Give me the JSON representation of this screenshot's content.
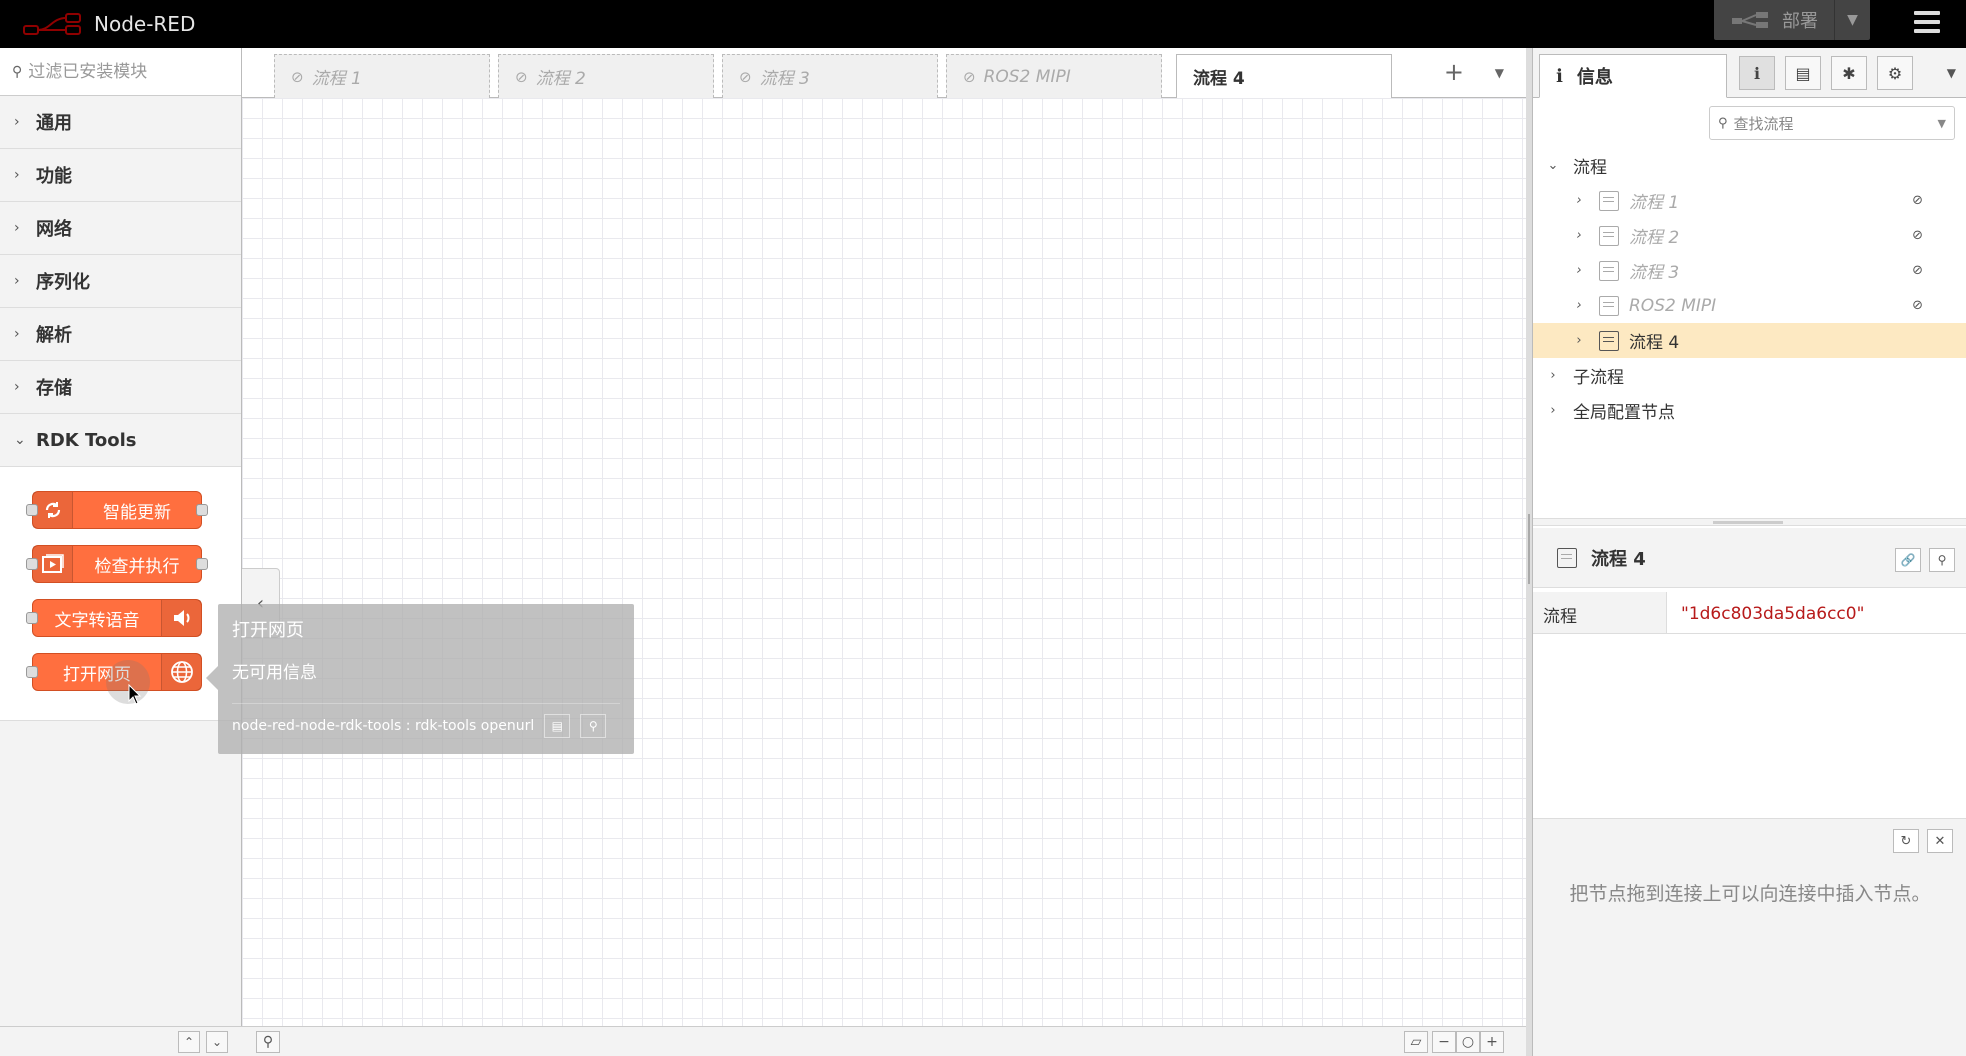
{
  "header": {
    "app_name": "Node-RED",
    "deploy_label": "部署"
  },
  "palette": {
    "search_placeholder": "过滤已安装模块",
    "categories": [
      "通用",
      "功能",
      "网络",
      "序列化",
      "解析",
      "存储"
    ],
    "open_category": "RDK Tools",
    "nodes": [
      {
        "label": "智能更新",
        "icon": "refresh-icon"
      },
      {
        "label": "检查并执行",
        "icon": "play-icon"
      },
      {
        "label": "文字转语音",
        "icon": "speaker-icon"
      },
      {
        "label": "打开网页",
        "icon": "globe-icon"
      }
    ],
    "node_color": "#ff6f3f"
  },
  "workspace": {
    "tabs": [
      {
        "label": "流程 1",
        "disabled": true
      },
      {
        "label": "流程 2",
        "disabled": true
      },
      {
        "label": "流程 3",
        "disabled": true
      },
      {
        "label": "ROS2 MIPI",
        "disabled": true
      },
      {
        "label": "流程 4",
        "disabled": false
      }
    ]
  },
  "tooltip": {
    "title": "打开网页",
    "body": "无可用信息",
    "footer": "node-red-node-rdk-tools : rdk-tools openurl"
  },
  "sidebar": {
    "tab_label": "信息",
    "search_placeholder": "查找流程",
    "tree_root": "流程",
    "flows": [
      {
        "label": "流程 1",
        "disabled": true
      },
      {
        "label": "流程 2",
        "disabled": true
      },
      {
        "label": "流程 3",
        "disabled": true
      },
      {
        "label": "ROS2 MIPI",
        "disabled": true
      },
      {
        "label": "流程 4",
        "disabled": false
      }
    ],
    "subflows_label": "子流程",
    "global_config_label": "全局配置节点",
    "props_title": "流程 4",
    "props_key": "流程",
    "props_value": "\"1d6c803da5da6cc0\"",
    "tip": "把节点拖到连接上可以向连接中插入节点。",
    "active_color": "#fde9c2"
  }
}
